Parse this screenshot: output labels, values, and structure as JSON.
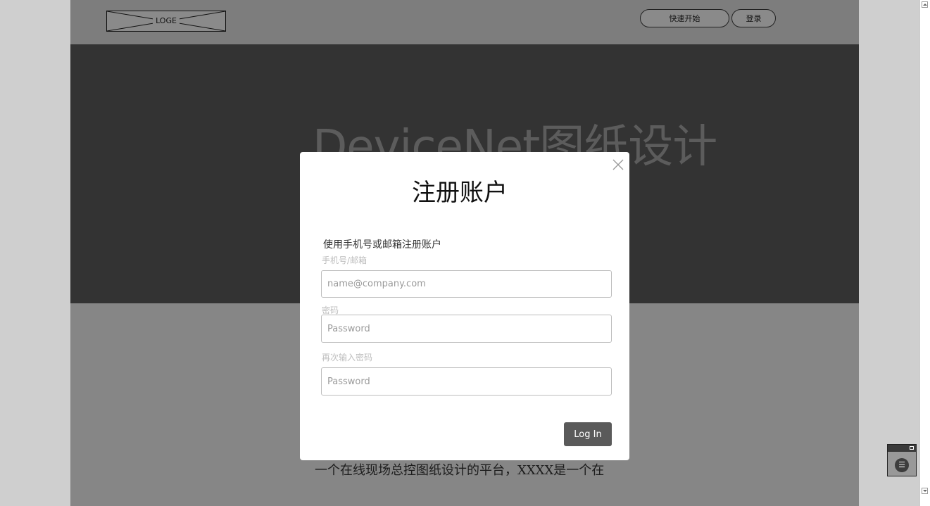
{
  "header": {
    "logo_text": "LOGE",
    "quick_start_label": "快速开始",
    "login_label": "登录"
  },
  "hero": {
    "title": "DeviceNet图纸设计"
  },
  "lower": {
    "description": "一个在线现场总控图纸设计的平台，XXXX是一个在"
  },
  "modal": {
    "title": "注册账户",
    "subtitle": "使用手机号或邮箱注册账户",
    "account_label": "手机号/邮箱",
    "account_placeholder": "name@company.com",
    "password_label": "密码",
    "password_placeholder": "Password",
    "confirm_label": "再次输入密码",
    "confirm_placeholder": "Password",
    "submit_label": "Log In"
  },
  "icons": {
    "close": "close-icon",
    "menu": "menu-icon"
  }
}
